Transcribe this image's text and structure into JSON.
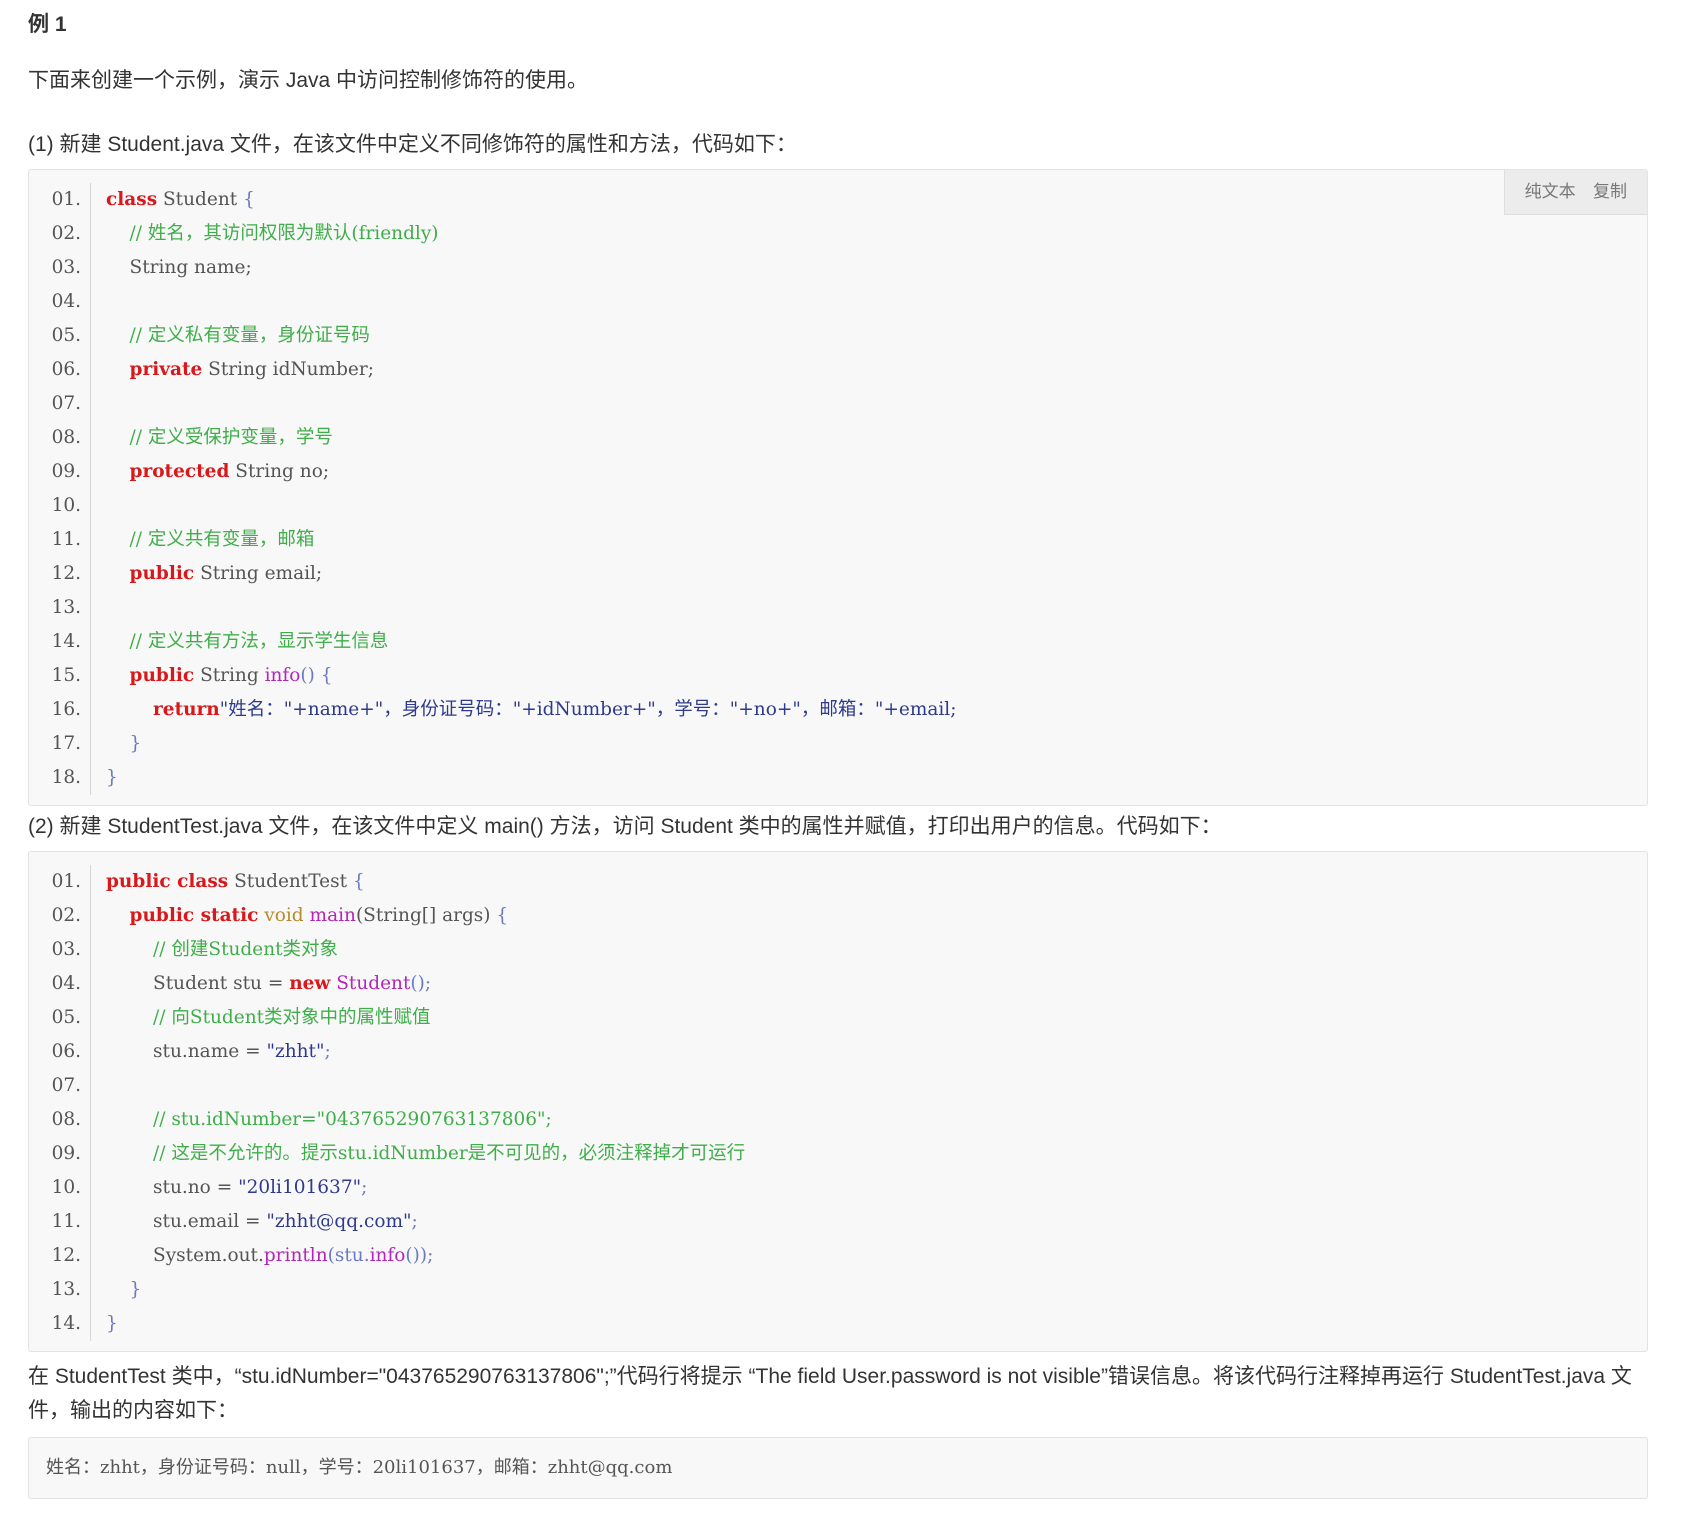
{
  "heading": "例 1",
  "intro": "下面来创建一个示例，演示 Java 中访问控制修饰符的使用。",
  "step1": "(1) 新建 Student.java 文件，在该文件中定义不同修饰符的属性和方法，代码如下：",
  "toolbar": {
    "plain_text": "纯文本",
    "copy": "复制"
  },
  "code1_line_numbers": [
    "01.",
    "02.",
    "03.",
    "04.",
    "05.",
    "06.",
    "07.",
    "08.",
    "09.",
    "10.",
    "11.",
    "12.",
    "13.",
    "14.",
    "15.",
    "16.",
    "17.",
    "18."
  ],
  "code1_text": {
    "l1_kw": "class",
    "l1_rest": " Student ",
    "l1_brace": "{",
    "l2_cm": "// 姓名，其访问权限为默认(friendly)",
    "l3": "String name;",
    "l5_cm": "// 定义私有变量，身份证号码",
    "l6_kw": "private",
    "l6_rest": " String idNumber;",
    "l8_cm": "// 定义受保护变量，学号",
    "l9_kw": "protected",
    "l9_rest": " String no;",
    "l11_cm": "// 定义共有变量，邮箱",
    "l12_kw": "public",
    "l12_rest": " String email;",
    "l14_cm": "// 定义共有方法，显示学生信息",
    "l15_kw": "public",
    "l15_ty": " String ",
    "l15_fn": "info",
    "l15_rest": "() {",
    "l16_kw": "return",
    "l16_rest": "\"姓名：\"+name+\"，身份证号码：\"+idNumber+\"，学号：\"+no+\"，邮箱：\"+email;",
    "l17": "}",
    "l18": "}"
  },
  "step2": "(2) 新建 StudentTest.java 文件，在该文件中定义 main() 方法，访问 Student 类中的属性并赋值，打印出用户的信息。代码如下：",
  "code2_line_numbers": [
    "01.",
    "02.",
    "03.",
    "04.",
    "05.",
    "06.",
    "07.",
    "08.",
    "09.",
    "10.",
    "11.",
    "12.",
    "13.",
    "14."
  ],
  "code2_text": {
    "l1_kw": "public class",
    "l1_rest": " StudentTest ",
    "l1_brace": "{",
    "l2_kw": "public static",
    "l2_void": " void ",
    "l2_fn": "main",
    "l2_rest": "(String[] args) ",
    "l2_brace": "{",
    "l3_cm": "// 创建Student类对象",
    "l4_a": "Student stu = ",
    "l4_kw": "new",
    "l4_fn": " Student",
    "l4_rest": "();",
    "l5_cm": "// 向Student类对象中的属性赋值",
    "l6_a": "stu.name = ",
    "l6_str": "\"zhht\"",
    "l6_rest": ";",
    "l8_cm": "// stu.idNumber=\"043765290763137806\";",
    "l9_cm": "// 这是不允许的。提示stu.idNumber是不可见的，必须注释掉才可运行",
    "l10_a": "stu.no = ",
    "l10_str": "\"20li101637\"",
    "l10_rest": ";",
    "l11_a": "stu.email = ",
    "l11_str": "\"zhht@qq.com\"",
    "l11_rest": ";",
    "l12_a": "System.out.",
    "l12_fn": "println",
    "l12_b": "(stu.",
    "l12_fn2": "info",
    "l12_rest": "());",
    "l13": "}",
    "l14": "}"
  },
  "result_text": "在 StudentTest 类中，“stu.idNumber=\"043765290763137806\";”代码行将提示 “The field User.password is not visible”错误信息。将该代码行注释掉再运行 StudentTest.java 文件，输出的内容如下：",
  "output": "姓名：zhht，身份证号码：null，学号：20li101637，邮箱：zhht@qq.com"
}
